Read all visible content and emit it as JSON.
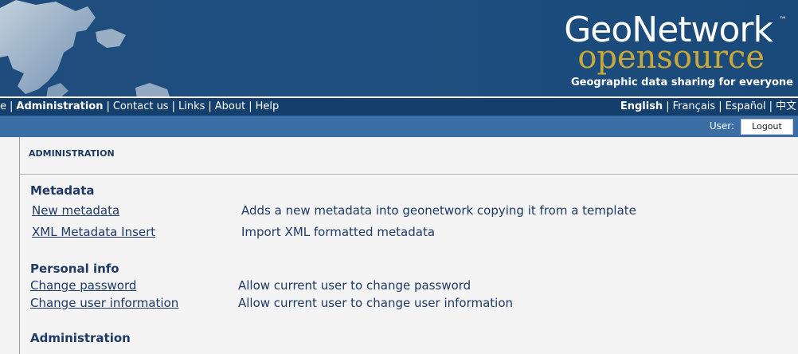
{
  "banner": {
    "logo_primary": "GeoNetwork",
    "logo_tm": "™",
    "logo_secondary": "opensource",
    "tagline": "Geographic data sharing for everyone"
  },
  "nav": {
    "left_items": [
      {
        "label": "e"
      },
      {
        "label": "Administration"
      },
      {
        "label": "Contact us"
      },
      {
        "label": "Links"
      },
      {
        "label": "About"
      },
      {
        "label": "Help"
      }
    ],
    "languages": [
      {
        "label": "English"
      },
      {
        "label": "Français"
      },
      {
        "label": "Español"
      },
      {
        "label": "中文"
      }
    ]
  },
  "userbar": {
    "user_label": "User:",
    "logout_label": "Logout"
  },
  "content": {
    "section_title": "ADMINISTRATION",
    "groups": [
      {
        "heading": "Metadata",
        "items": [
          {
            "link": "New metadata",
            "description": "Adds a new metadata into geonetwork copying it from a template"
          },
          {
            "link": "XML Metadata Insert",
            "description": "Import XML formatted metadata"
          }
        ]
      },
      {
        "heading": "Personal info",
        "items": [
          {
            "link": "Change password",
            "description": "Allow current user to change password"
          },
          {
            "link": "Change user information",
            "description": "Allow current user to change user information"
          }
        ]
      },
      {
        "heading": "Administration",
        "items": []
      }
    ]
  },
  "colors": {
    "banner_bg": "#1d4c7d",
    "nav_bg": "#143f6c",
    "userbar_bg": "#3a6ea5",
    "content_bg": "#f4f4f4",
    "text_dark_blue": "#1f3a66",
    "logo_gold": "#c8a83a"
  },
  "icons": {
    "banner_map": "world-map-illustration"
  }
}
